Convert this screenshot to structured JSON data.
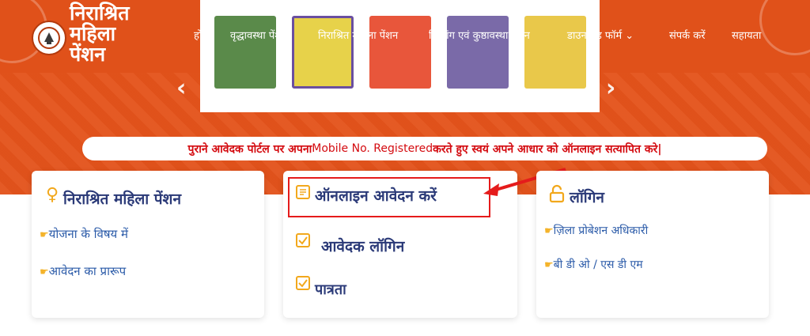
{
  "logo": {
    "line1": "निराश्रित",
    "line2": "महिला",
    "line3": "पेंशन"
  },
  "nav": [
    "होम",
    "वृद्धावस्था पेंशन",
    "निराश्रित महिला पेंशन",
    "दिव्यांग एवं कुष्ठावस्था पेंशन",
    "डाउनलोड फॉर्म ⌄",
    "संपर्क करें",
    "सहायता"
  ],
  "notice": {
    "part1": "पुराने आवेदक पोर्टल पर अपना ",
    "part2": "Mobile No. Registered",
    "part3": " करते हुए स्वयं अपने आधार को ऑनलाइन सत्यापित करे|"
  },
  "cards": {
    "left": {
      "title": "निराश्रित महिला पेंशन",
      "links": [
        "योजना के विषय में",
        "आवेदन का प्रारूप"
      ]
    },
    "middle": {
      "items": [
        "ऑनलाइन आवेदन करें",
        "आवेदक लॉगिन",
        "पात्रता"
      ]
    },
    "right": {
      "title": "लॉगिन",
      "links": [
        "ज़िला प्रोबेशन अधिकारी",
        "बी डी ओ / एस डी एम"
      ]
    }
  },
  "colors": {
    "brand_orange": "#e4531b",
    "title_navy": "#2b3a78",
    "link_blue": "#2a5aa8",
    "notice_red": "#d40b10",
    "highlight_red": "#e51b1b",
    "icon_amber": "#f2a81c"
  },
  "icons": [
    "emblem-icon",
    "woman-icon",
    "hand-pointer-icon",
    "form-icon",
    "checkbox-icon",
    "lock-icon",
    "chevron-left-icon",
    "chevron-right-icon",
    "red-arrow-icon"
  ]
}
